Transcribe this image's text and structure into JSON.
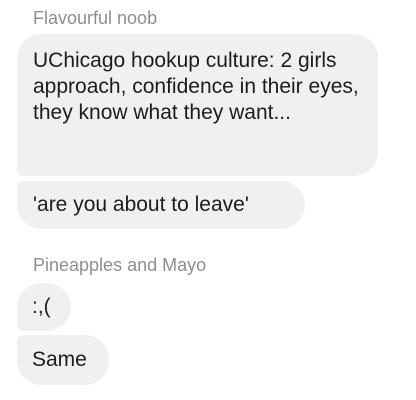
{
  "conversation": {
    "groups": [
      {
        "sender": "Flavourful noob",
        "messages": [
          "UChicago hookup culture: 2 girls approach, confidence in their eyes, they know what they want...",
          "'are you about to leave'"
        ]
      },
      {
        "sender": "Pineapples and Mayo",
        "messages": [
          ":,(",
          "Same"
        ]
      }
    ]
  },
  "colors": {
    "bubble_background": "#f1f0f0",
    "sender_text": "#8e8e93",
    "message_text": "#1c1c1e"
  }
}
